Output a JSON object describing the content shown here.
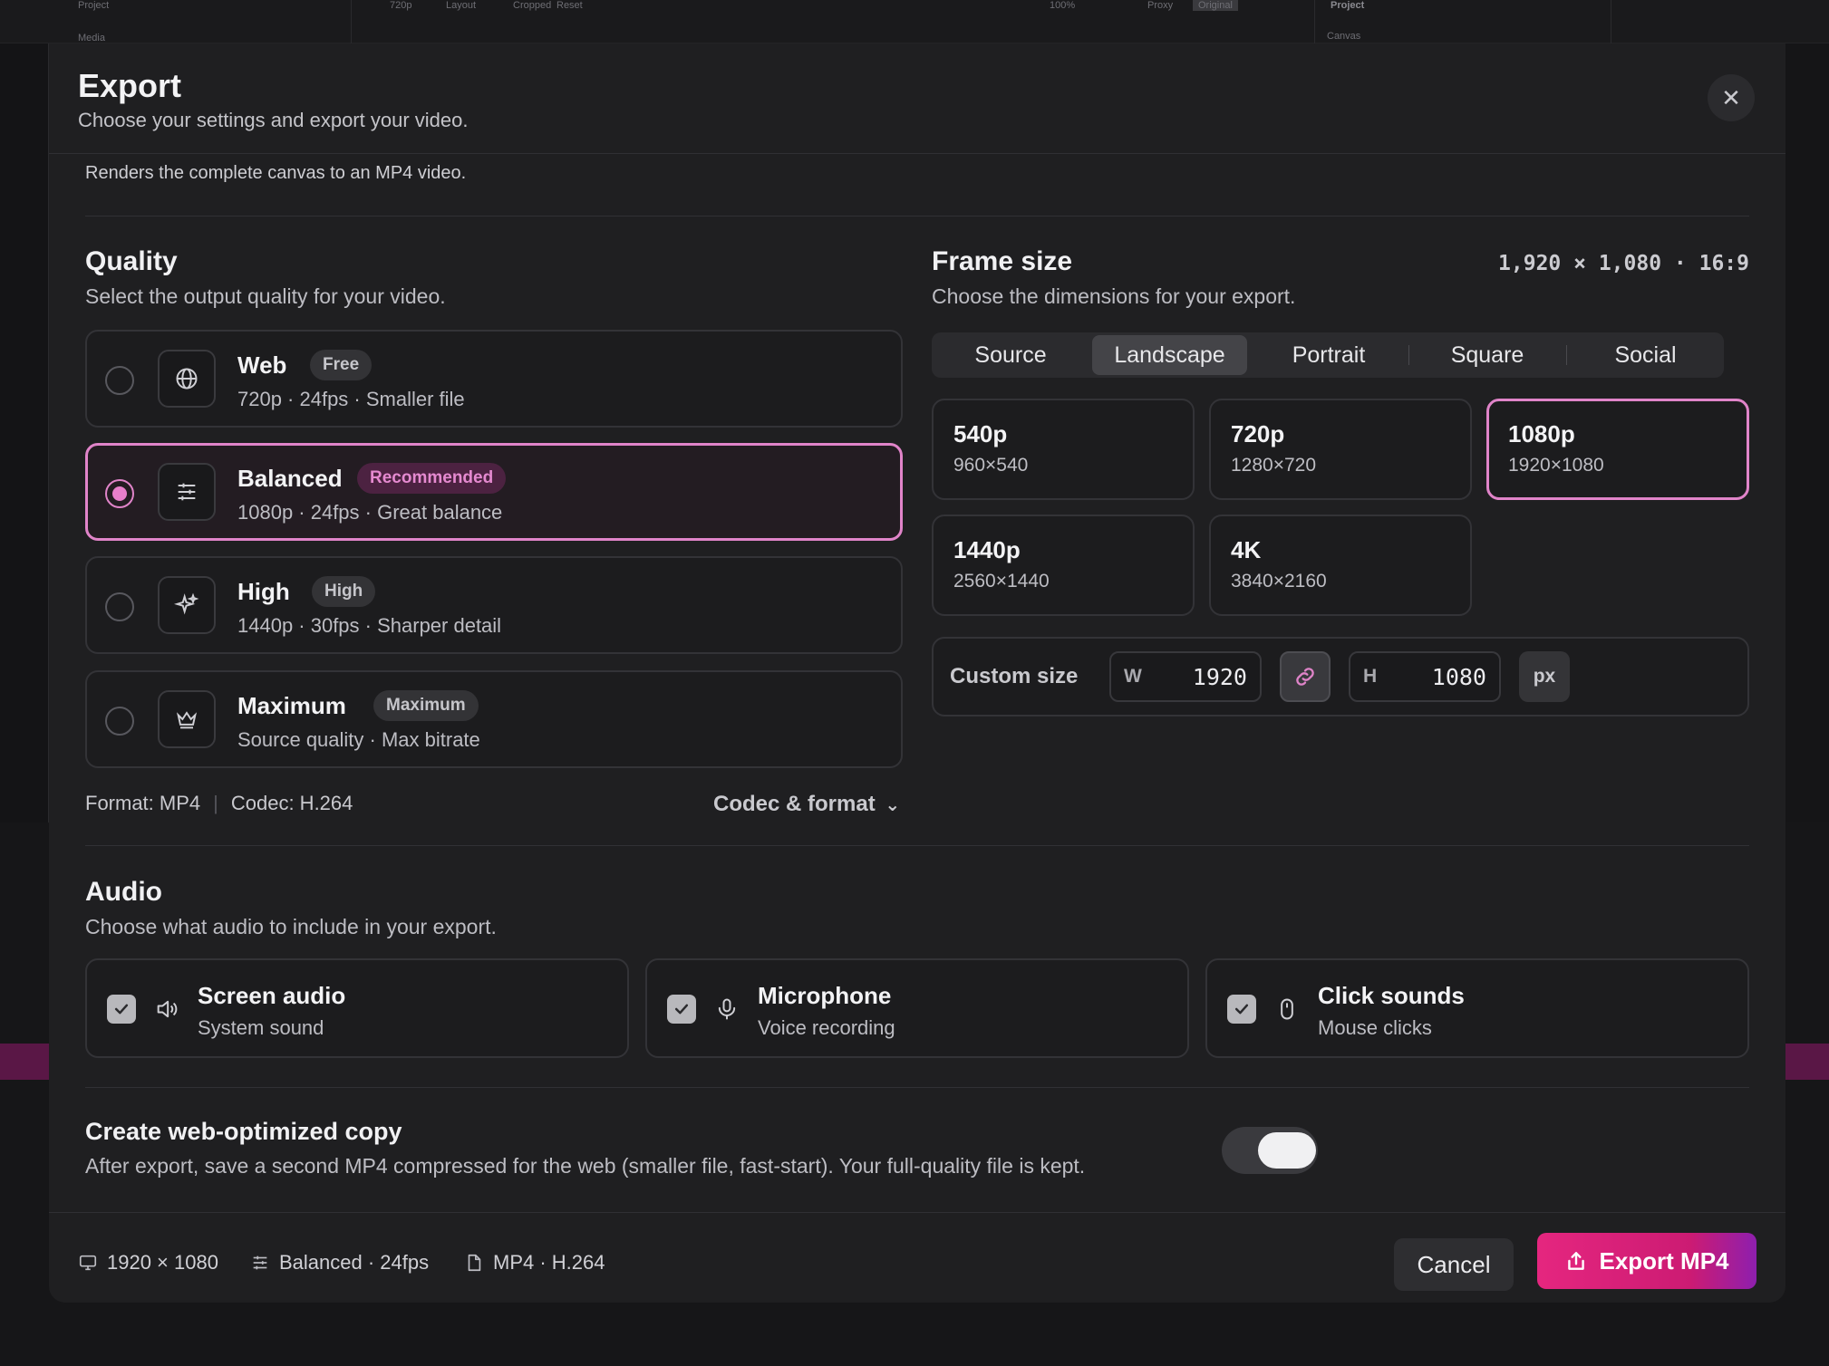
{
  "background": {
    "top_left_label": "Project",
    "left_item": "Media",
    "toolbar_quality": "720p",
    "toolbar_layout": "Layout",
    "toolbar_cropped": "Cropped",
    "toolbar_reset": "Reset",
    "zoom": "100%",
    "proxy": "Proxy",
    "original": "Original",
    "right_label": "Project",
    "right_sub": "Canvas"
  },
  "modal": {
    "title": "Export",
    "subtitle": "Choose your settings and export your video.",
    "close_glyph": "✕",
    "description": "Renders the complete canvas to an MP4 video."
  },
  "quality": {
    "title": "Quality",
    "subtitle": "Select the output quality for your video.",
    "options": [
      {
        "name": "Web",
        "badge": "Free",
        "detail": "720p · 24fps · Smaller file",
        "icon": "globe-icon",
        "selected": false
      },
      {
        "name": "Balanced",
        "badge": "Recommended",
        "detail": "1080p · 24fps · Great balance",
        "icon": "sliders-icon",
        "selected": true
      },
      {
        "name": "High",
        "badge": "High",
        "detail": "1440p · 30fps · Sharper detail",
        "icon": "sparkles-icon",
        "selected": false
      },
      {
        "name": "Maximum",
        "badge": "Maximum",
        "detail": "Source quality · Max bitrate",
        "icon": "crown-icon",
        "selected": false
      }
    ],
    "format": "Format: MP4",
    "separator": "|",
    "codec": "Codec: H.264",
    "codec_link": "Codec & format",
    "codec_chevron": "⌄"
  },
  "frame_size": {
    "title": "Frame size",
    "subtitle": "Choose the dimensions for your export.",
    "dimensions": "1,920 × 1,080 · 16:9",
    "tabs": [
      "Source",
      "Landscape",
      "Portrait",
      "Square",
      "Social"
    ],
    "active_tab": "Landscape",
    "presets": [
      {
        "name": "540p",
        "res": "960×540"
      },
      {
        "name": "720p",
        "res": "1280×720"
      },
      {
        "name": "1080p",
        "res": "1920×1080"
      },
      {
        "name": "1440p",
        "res": "2560×1440"
      },
      {
        "name": "4K",
        "res": "3840×2160"
      }
    ],
    "selected_preset": "1080p",
    "custom_label": "Custom size",
    "width_prefix": "W",
    "width": "1920",
    "height_prefix": "H",
    "height": "1080",
    "unit": "px"
  },
  "audio": {
    "title": "Audio",
    "subtitle": "Choose what audio to include in your export.",
    "options": [
      {
        "name": "Screen audio",
        "sub": "System sound",
        "checked": true,
        "icon": "speaker-icon"
      },
      {
        "name": "Microphone",
        "sub": "Voice recording",
        "checked": true,
        "icon": "microphone-icon"
      },
      {
        "name": "Click sounds",
        "sub": "Mouse clicks",
        "checked": true,
        "icon": "mouse-icon"
      }
    ]
  },
  "web_copy": {
    "title": "Create web-optimized copy",
    "description": "After export, save a second MP4 compressed for the web (smaller file, fast-start). Your full-quality file is kept.",
    "enabled": true
  },
  "footer": {
    "resolution": "1920 × 1080",
    "quality": "Balanced · 24fps",
    "format": "MP4 · H.264",
    "cancel": "Cancel",
    "export": "Export MP4"
  },
  "colors": {
    "accent": "#e084c9",
    "export_gradient_start": "#e5267f",
    "export_gradient_end": "#8e1fae"
  }
}
